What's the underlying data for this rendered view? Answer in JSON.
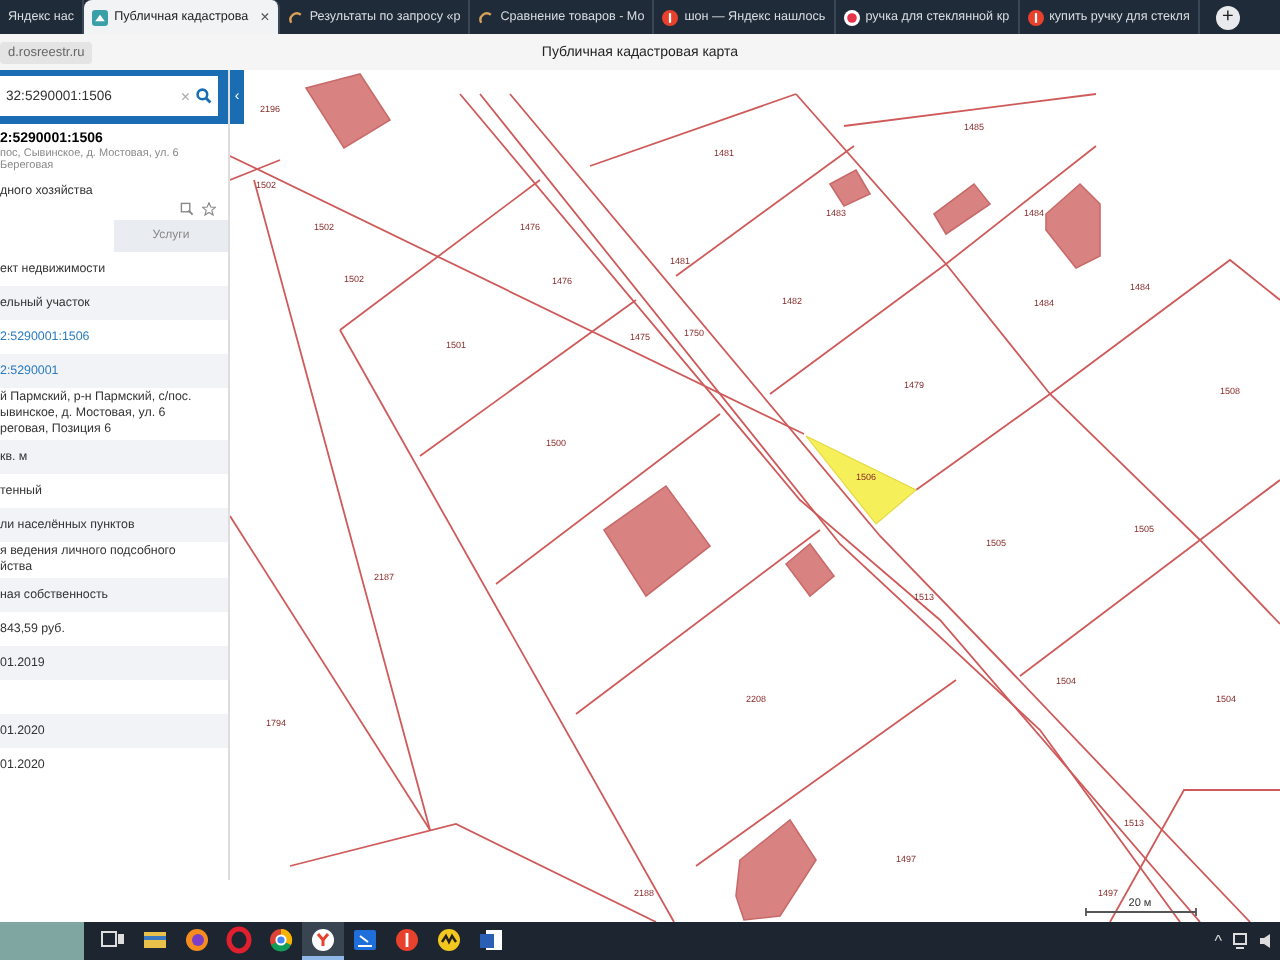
{
  "browser": {
    "tabs": [
      {
        "title": "Яндекс нас",
        "selected": false
      },
      {
        "title": "Публичная кадастрова",
        "selected": true,
        "close": "×"
      },
      {
        "title": "Результаты по запросу «р",
        "selected": false
      },
      {
        "title": "Сравнение товаров - Мо",
        "selected": false
      },
      {
        "title": "шон — Яндекс нашлось",
        "selected": false
      },
      {
        "title": "ручка для стеклянной кр",
        "selected": false
      },
      {
        "title": "купить ручку для стекля",
        "selected": false
      }
    ],
    "new_tab": "+",
    "address": "d.rosreestr.ru",
    "page_title": "Публичная кадастровая карта"
  },
  "panel": {
    "search_value": "32:5290001:1506",
    "clear": "×",
    "collapse": "‹",
    "object_number": "2:5290001:1506",
    "object_address": "пос, Сывинское, д. Мостовая, ул. 6 Береговая",
    "object_use": "дного хозяйства",
    "tabs": [
      {
        "label": "Услуги",
        "selected": false
      }
    ],
    "rows": [
      {
        "kind": "text",
        "lines": [
          "ект недвижимости"
        ]
      },
      {
        "kind": "text",
        "lines": [
          "ельный участок"
        ]
      },
      {
        "kind": "link",
        "lines": [
          "2:5290001:1506"
        ]
      },
      {
        "kind": "link",
        "lines": [
          "2:5290001"
        ]
      },
      {
        "kind": "text",
        "lines": [
          "й Пармский, р-н Пармский, с/пос.",
          "ывинское, д. Мостовая, ул. 6",
          "реговая, Позиция 6"
        ]
      },
      {
        "kind": "text",
        "lines": [
          "кв. м"
        ]
      },
      {
        "kind": "text",
        "lines": [
          "тенный"
        ]
      },
      {
        "kind": "text",
        "lines": [
          "ли населённых пунктов"
        ]
      },
      {
        "kind": "text",
        "lines": [
          "я ведения личного подсобного",
          "йства"
        ]
      },
      {
        "kind": "text",
        "lines": [
          "ная собственность"
        ]
      },
      {
        "kind": "text",
        "lines": [
          "843,59 руб."
        ]
      },
      {
        "kind": "text",
        "lines": [
          "01.2019"
        ]
      },
      {
        "kind": "blank"
      },
      {
        "kind": "text",
        "lines": [
          "01.2020"
        ]
      },
      {
        "kind": "text",
        "lines": [
          "01.2020"
        ]
      }
    ]
  },
  "map": {
    "parcel_labels": [
      "2196",
      "1485",
      "1481",
      "1502",
      "1483",
      "1484",
      "1502",
      "1476",
      "1481",
      "1502",
      "1476",
      "1484",
      "1482",
      "1484",
      "1501",
      "1475",
      "1750",
      "1479",
      "1508",
      "1500",
      "1506",
      "1505",
      "1505",
      "2187",
      "1513",
      "1504",
      "2208",
      "1504",
      "1794",
      "1513",
      "1497",
      "2188",
      "1497"
    ],
    "scale": "20 м"
  },
  "taskbar": {
    "apps": [
      {
        "kind": "taskview",
        "active": false
      },
      {
        "kind": "explorer",
        "active": false
      },
      {
        "kind": "firefox",
        "active": false
      },
      {
        "kind": "opera",
        "active": false
      },
      {
        "kind": "chrome",
        "active": false
      },
      {
        "kind": "yabrowser",
        "active": true
      },
      {
        "kind": "bluebox",
        "active": false
      },
      {
        "kind": "yandex",
        "active": false
      },
      {
        "kind": "yellow",
        "active": false
      },
      {
        "kind": "word",
        "active": false
      }
    ],
    "tray_caret": "^"
  }
}
